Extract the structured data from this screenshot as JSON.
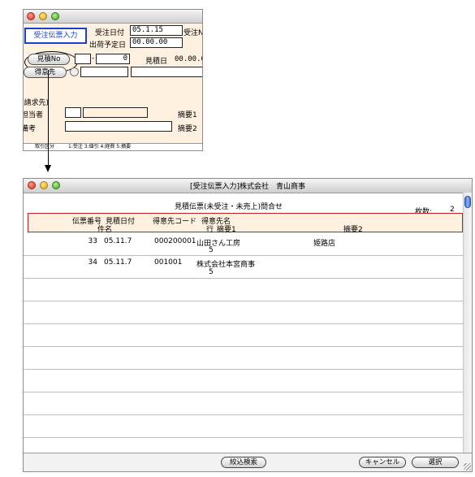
{
  "top_window": {
    "form_title": "受注伝票入力",
    "labels": {
      "order_date": "受注日付",
      "order_date_value": "05.1.15",
      "order_no_cut": "受注N",
      "ship_date": "出荷予定日",
      "ship_date_value": "00.00.00",
      "estimate_no_button": "見積No",
      "estimate_no_value": "0",
      "estimate_date": "見積日",
      "estimate_date_value": "00.00.0",
      "customer_button": "得意先",
      "billing": "(請求先)",
      "staff": "担当者",
      "summary1": "摘要1",
      "remarks": "備考",
      "summary2": "摘要2",
      "status_left": "取引区分",
      "status_right": "1:受注 3:値引 4:経費 5:摘要"
    }
  },
  "main_window": {
    "title": "[受注伝票入力]株式会社　青山商事",
    "subtitle": "見積伝票(未受注・未売上)問合せ",
    "count_label": "枚数:",
    "count_value": "2",
    "headers": {
      "slip_no": "伝票番号",
      "estimate_date": "見積日付",
      "item_name": "件名",
      "customer_code": "得意先コード",
      "customer_name": "得意先名",
      "row": "行",
      "summary1": "摘要1",
      "summary2": "摘要2"
    },
    "rows": [
      {
        "slip_no": "33",
        "date": "05.11.7",
        "code": "000200001",
        "name": "山田さん工房",
        "summary2": "姫路店",
        "row": "5"
      },
      {
        "slip_no": "34",
        "date": "05.11.7",
        "code": "001001",
        "name": "株式会社本宮商事",
        "summary2": "",
        "row": "5"
      }
    ],
    "buttons": {
      "filter": "絞込検索",
      "cancel": "キャンセル",
      "select": "選択"
    }
  }
}
